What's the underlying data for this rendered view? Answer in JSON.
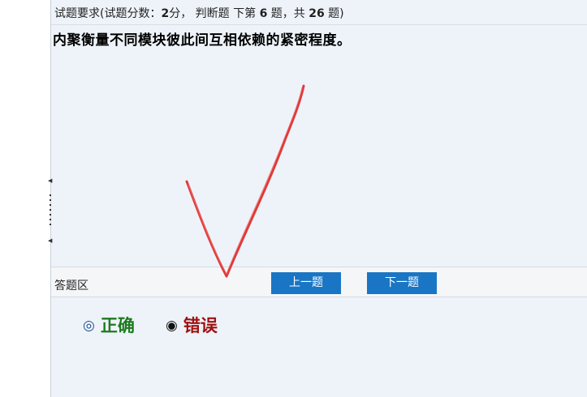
{
  "question": {
    "header": {
      "prefix": "试题要求(试题分数：",
      "score": "2",
      "mid": "分， 判断题 下第 ",
      "number": "6",
      "mid2": " 题，共 ",
      "total": "26",
      "suffix": " 题)"
    },
    "text": "内聚衡量不同模块彼此间互相依赖的紧密程度。"
  },
  "answer": {
    "label": "答题区",
    "prev_label": "上一题",
    "next_label": "下一题",
    "options": [
      {
        "radio": "◎",
        "label": "正确",
        "selected": false
      },
      {
        "radio": "◉",
        "label": "错误",
        "selected": true
      }
    ]
  },
  "annotation": {
    "icon": "red-checkmark-icon",
    "color": "#e03a3a"
  }
}
